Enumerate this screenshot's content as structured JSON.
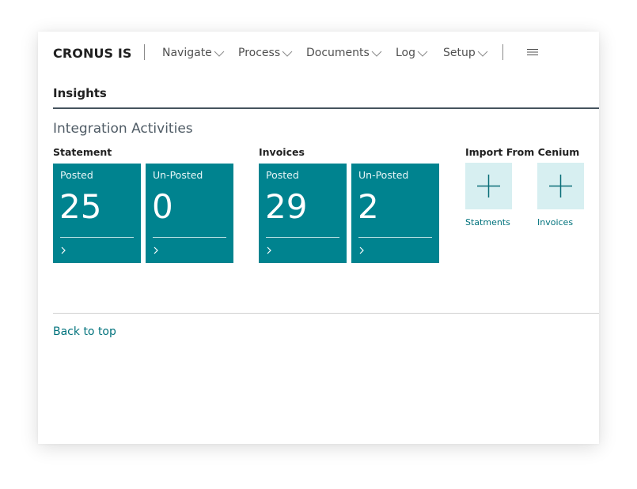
{
  "header": {
    "company": "CRONUS IS",
    "menu": [
      "Navigate",
      "Process",
      "Documents",
      "Log",
      "Setup"
    ]
  },
  "insights": {
    "title": "Insights"
  },
  "activities": {
    "title": "Integration Activities",
    "groups": [
      {
        "title": "Statement",
        "tiles": [
          {
            "label": "Posted",
            "value": "25"
          },
          {
            "label": "Un-Posted",
            "value": "0"
          }
        ]
      },
      {
        "title": "Invoices",
        "tiles": [
          {
            "label": "Posted",
            "value": "29"
          },
          {
            "label": "Un-Posted",
            "value": "2"
          }
        ]
      }
    ],
    "import": {
      "title": "Import From Cenium",
      "actions": [
        "Statments",
        "Invoices"
      ]
    }
  },
  "footer": {
    "back_to_top": "Back to top"
  },
  "colors": {
    "tile": "#00838f",
    "action_tile": "#d7eff1",
    "link": "#00727c"
  },
  "icons": {
    "menu_chevron": "chevron-down-icon",
    "hamburger": "hamburger-icon",
    "tile_arrow": "chevron-right-icon",
    "action": "plus-icon"
  }
}
